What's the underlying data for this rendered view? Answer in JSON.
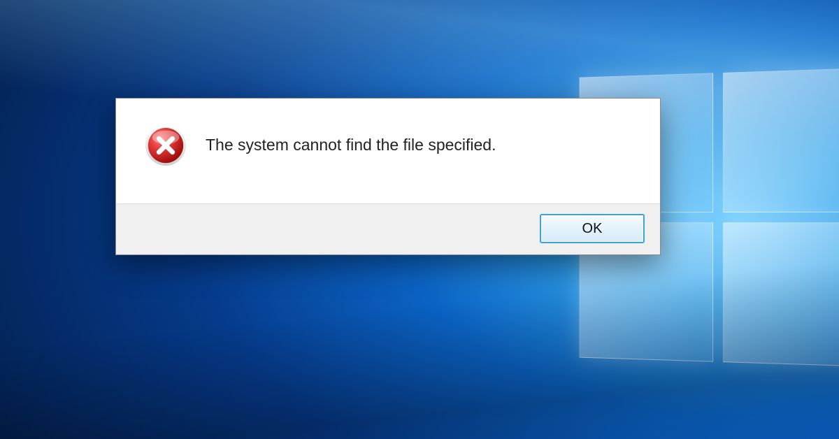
{
  "dialog": {
    "message": "The system cannot find the file specified.",
    "ok_label": "OK",
    "icon_name": "error-icon"
  },
  "colors": {
    "error_red": "#cc1f1f",
    "button_border": "#3ba4d8"
  }
}
